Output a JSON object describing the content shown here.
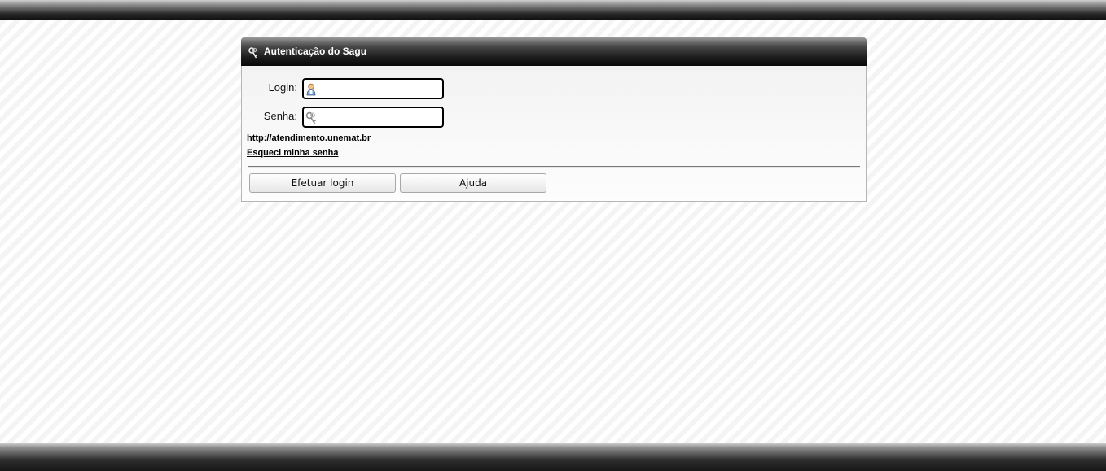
{
  "panel": {
    "title": "Autenticação do Sagu",
    "icon": "keys-icon"
  },
  "form": {
    "login_label": "Login:",
    "login_value": "",
    "login_icon": "user-icon",
    "password_label": "Senha:",
    "password_value": "",
    "password_icon": "keys-icon"
  },
  "links": {
    "site": "http://atendimento.unemat.br",
    "forgot_password": "Esqueci minha senha"
  },
  "buttons": {
    "login": "Efetuar login",
    "help": "Ajuda"
  }
}
